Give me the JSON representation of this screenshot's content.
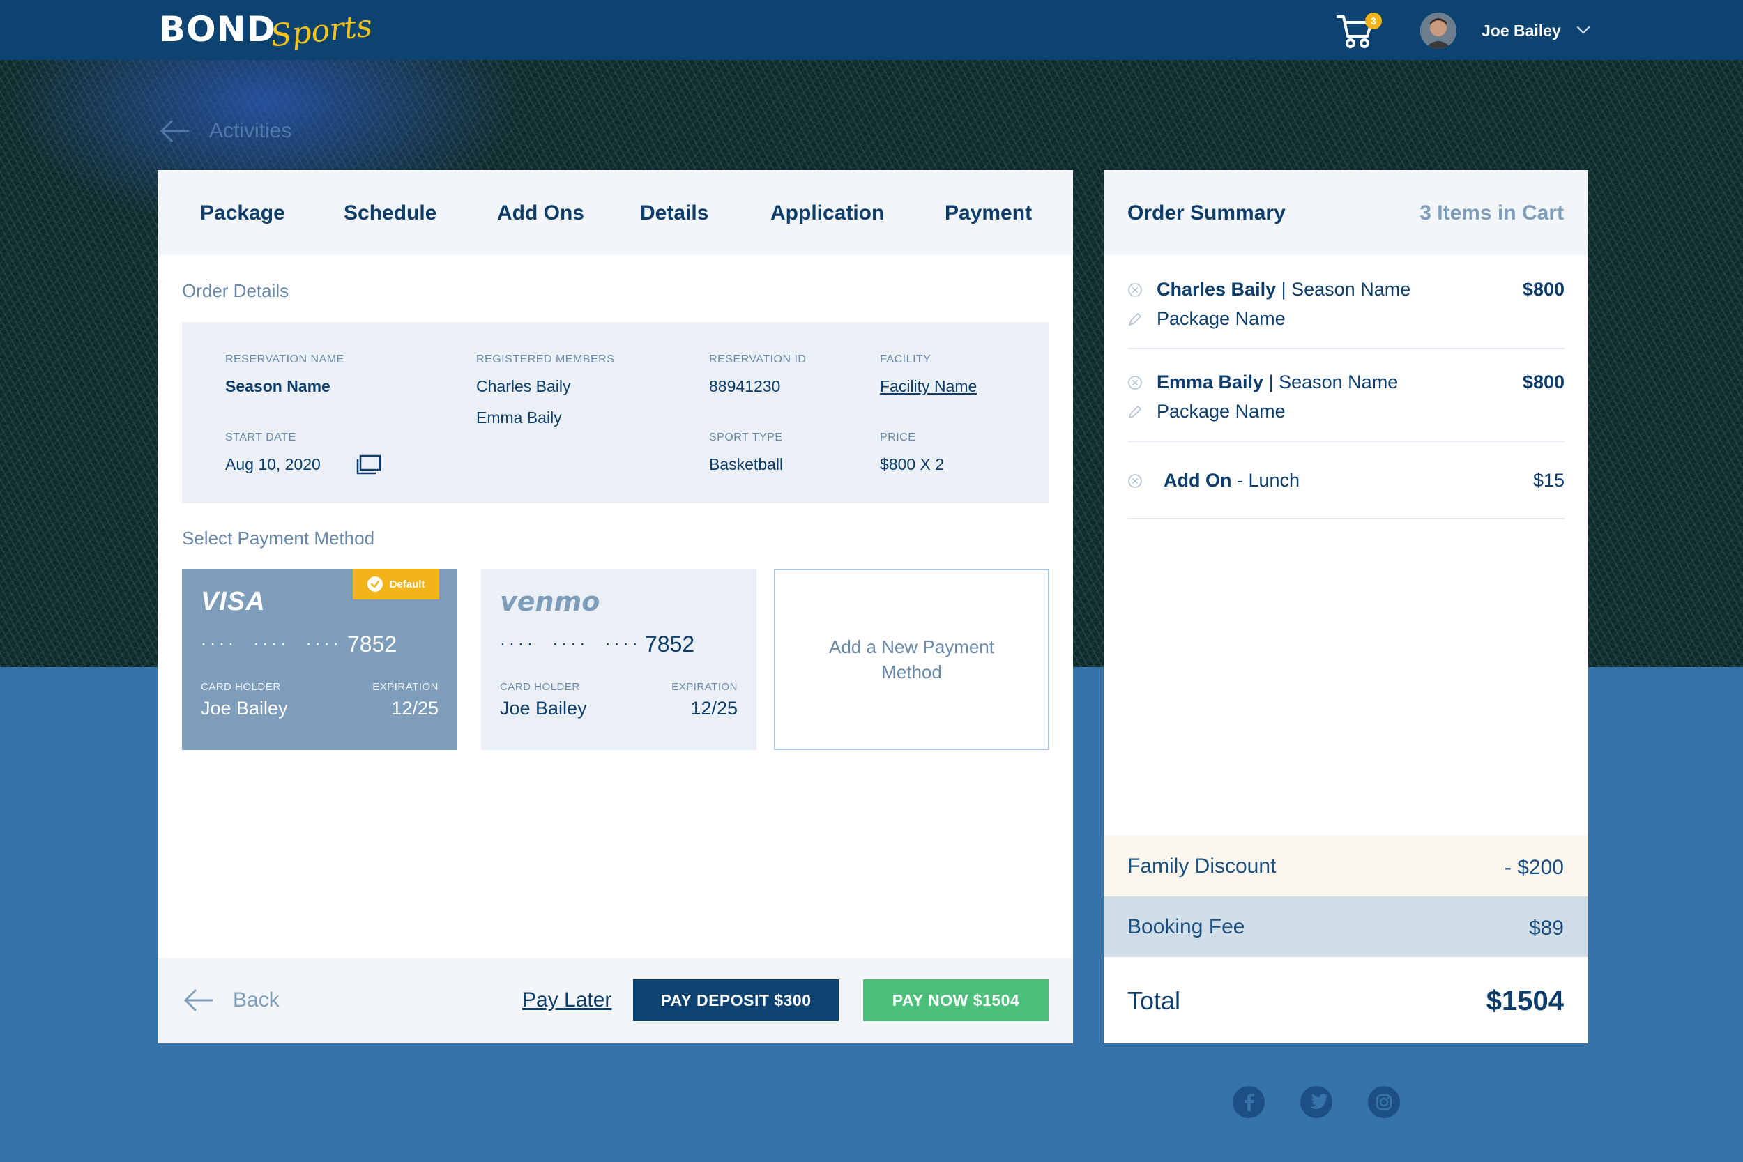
{
  "header": {
    "logo_main": "BOND",
    "logo_script": "Sports",
    "cart_count": "3",
    "user_name": "Joe Bailey"
  },
  "nav": {
    "back_link": "Activities"
  },
  "steps": {
    "tabs": [
      "Package",
      "Schedule",
      "Add Ons",
      "Details",
      "Application",
      "Payment"
    ]
  },
  "order_details": {
    "title": "Order Details",
    "reservation_name_label": "RESERVATION NAME",
    "reservation_name": "Season Name",
    "registered_members_label": "REGISTERED MEMBERS",
    "members": [
      "Charles Baily",
      "Emma Baily"
    ],
    "reservation_id_label": "RESERVATION ID",
    "reservation_id": "88941230",
    "facility_label": "FACILITY",
    "facility": "Facility Name",
    "start_date_label": "START DATE",
    "start_date": "Aug 10, 2020",
    "sport_type_label": "SPORT TYPE",
    "sport_type": "Basketball",
    "price_label": "PRICE",
    "price": "$800 X 2"
  },
  "payment": {
    "title": "Select Payment Method",
    "cards": [
      {
        "brand": "VISA",
        "badge": "Default",
        "masked": "····  ····  ····",
        "last4": "7852",
        "holder_label": "CARD HOLDER",
        "holder": "Joe Bailey",
        "expiration_label": "EXPIRATION",
        "expiration": "12/25"
      },
      {
        "brand": "venmo",
        "masked": "····  ····  ····",
        "last4": "7852",
        "holder_label": "CARD HOLDER",
        "holder": "Joe Bailey",
        "expiration_label": "EXPIRATION",
        "expiration": "12/25"
      }
    ],
    "add_new_label": "Add a New Payment Method"
  },
  "footer": {
    "back_label": "Back",
    "pay_later_label": "Pay Later",
    "pay_deposit_label": "PAY DEPOSIT $300",
    "pay_now_label": "PAY NOW $1504"
  },
  "summary": {
    "title": "Order Summary",
    "items_count": "3 Items in Cart",
    "items": [
      {
        "member": "Charles Baily",
        "separator": " | ",
        "season": "Season Name",
        "package": "Package Name",
        "price": "$800"
      },
      {
        "member": "Emma Baily",
        "separator": " | ",
        "season": "Season Name",
        "package": "Package Name",
        "price": "$800"
      },
      {
        "addon_label": "Add On",
        "addon_name": " - Lunch",
        "price": "$15"
      }
    ],
    "discount_label": "Family Discount",
    "discount_value": "- $200",
    "fee_label": "Booking Fee",
    "fee_value": "$89",
    "total_label": "Total",
    "total_value": "$1504"
  },
  "colors": {
    "header_bg": "#0d4370",
    "primary_text": "#0d3e6b",
    "muted_text": "#6a89a8",
    "accent_yellow": "#f2b418",
    "pay_now_green": "#4cc07a",
    "visa_card_bg": "#7d9dba",
    "page_blue": "#3573a8"
  },
  "icons": [
    "cart-icon",
    "chevron-down-icon",
    "arrow-left-icon",
    "calendar-icon",
    "check-icon",
    "remove-circle-icon",
    "pencil-icon",
    "facebook-icon",
    "twitter-icon",
    "instagram-icon"
  ]
}
